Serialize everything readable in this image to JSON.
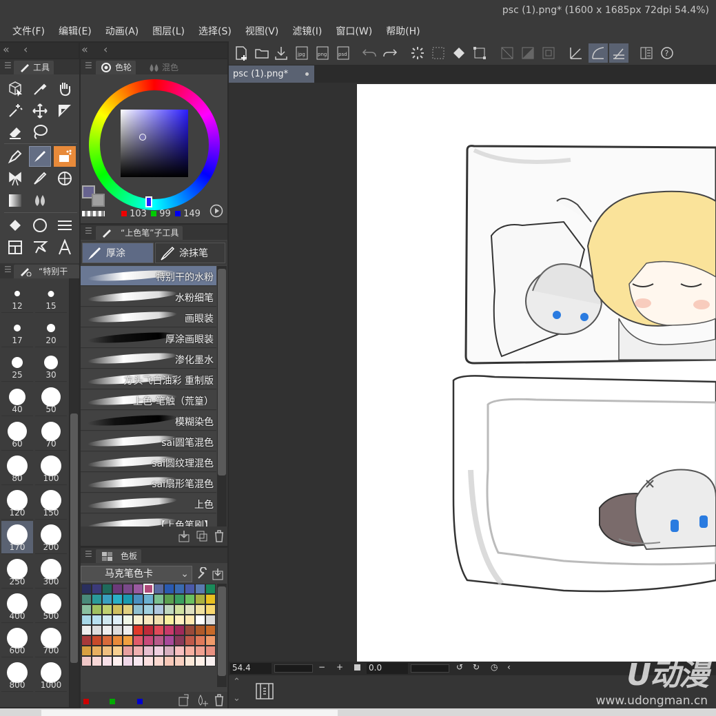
{
  "window": {
    "title": "psc (1).png* (1600 x 1685px 72dpi 54.4%)"
  },
  "menu": [
    "文件(F)",
    "编辑(E)",
    "动画(A)",
    "图层(L)",
    "选择(S)",
    "视图(V)",
    "滤镜(I)",
    "窗口(W)",
    "帮助(H)"
  ],
  "tool_panel": {
    "tab": "工具"
  },
  "color_panel": {
    "tab_wheel": "色轮",
    "tab_mix": "混色",
    "r": "103",
    "g": "99",
    "b": "149",
    "main_color": "#67638f"
  },
  "subtool_panel": {
    "header": "“上色笔”子工具",
    "tabs": [
      "厚涂",
      "涂抹笔"
    ],
    "brushes": [
      "特别干的水粉",
      "水粉细笔",
      "画眼装",
      "厚涂画眼装",
      "渗化墨水",
      "方头飞白油彩 重制版",
      "上色-笔触（荒篁）",
      "模糊染色",
      "sai圆笔混色",
      "sai圆纹理混色",
      "sai扇形笔混色",
      "上色",
      "【上色笔刷】"
    ]
  },
  "brush_size_panel": {
    "header": "“特别干的",
    "sizes": [
      "12",
      "15",
      "17",
      "20",
      "25",
      "30",
      "40",
      "50",
      "60",
      "70",
      "80",
      "100",
      "120",
      "150",
      "170",
      "200",
      "250",
      "300",
      "400",
      "500",
      "600",
      "700",
      "800",
      "1000"
    ],
    "selected": "170"
  },
  "palette_panel": {
    "tab": "色板",
    "set_name": "马克笔色卡"
  },
  "document": {
    "tab": "psc (1).png*"
  },
  "status": {
    "zoom": "54.4",
    "rotation": "0.0"
  },
  "watermark": {
    "logo": "U动漫",
    "url": "www.udongman.cn"
  },
  "swatch_colors": [
    "#2a2f5e",
    "#3b3a7a",
    "#1f6a5c",
    "#6b3a7a",
    "#7a4a8a",
    "#9a5aa0",
    "#b04a7a",
    "#5a6aa0",
    "#2a5ab0",
    "#3a6ab0",
    "#4a5aa8",
    "#5a7ab0",
    "#1a8a5a",
    "#4a8a7a",
    "#2a9a9a",
    "#3aa0c0",
    "#2ab0c8",
    "#1a9ab0",
    "#4a90c0",
    "#6ab0d0",
    "#7ac090",
    "#5aa050",
    "#3aa060",
    "#6ac060",
    "#aab040",
    "#e8c020",
    "#8ac0a0",
    "#a0c060",
    "#c0d070",
    "#d0c060",
    "#e0d080",
    "#90c0d0",
    "#a0d0e0",
    "#b0c8e0",
    "#c0d8c0",
    "#d0e0a0",
    "#e0e0c0",
    "#f0e0a0",
    "#f8d870",
    "#a8d8e8",
    "#b8e0f0",
    "#d0e8f0",
    "#e0f0f8",
    "#f0f8e8",
    "#f8f0d0",
    "#f8e8c0",
    "#f0e0b0",
    "#f8f0a0",
    "#fff0c0",
    "#ffe8b0",
    "#ffffff",
    "#dddddd",
    "#eeeeee",
    "#dddddd",
    "#eeeeee",
    "#dddddd",
    "#eeeeee",
    "#e03a2a",
    "#c02a3a",
    "#e04a5a",
    "#c83a6a",
    "#a02a5a",
    "#9a4a3a",
    "#b05a2a",
    "#c86a2a",
    "#a83a3a",
    "#c84a2a",
    "#d86a3a",
    "#e88a3a",
    "#f0a040",
    "#e05a6a",
    "#c84a7a",
    "#b85a8a",
    "#a84a9a",
    "#8a3a5a",
    "#c05a4a",
    "#e07a5a",
    "#f09a6a",
    "#d8a040",
    "#e8b060",
    "#f0c080",
    "#f8d090",
    "#e8a0a0",
    "#f0b0b0",
    "#e8c0d0",
    "#f0d0e0",
    "#d8b0c0",
    "#f8c0c0",
    "#f8b0a0",
    "#f0a090",
    "#e89080",
    "#f0c8c8",
    "#f8d8d8",
    "#f8e0e8",
    "#fff0f0",
    "#f0d8e8",
    "#f8e8f0",
    "#fce0e0",
    "#fcd8d0",
    "#f8c8b8",
    "#f8d0c0",
    "#fce8d8",
    "#fff0e8",
    "#f8f0f0"
  ]
}
